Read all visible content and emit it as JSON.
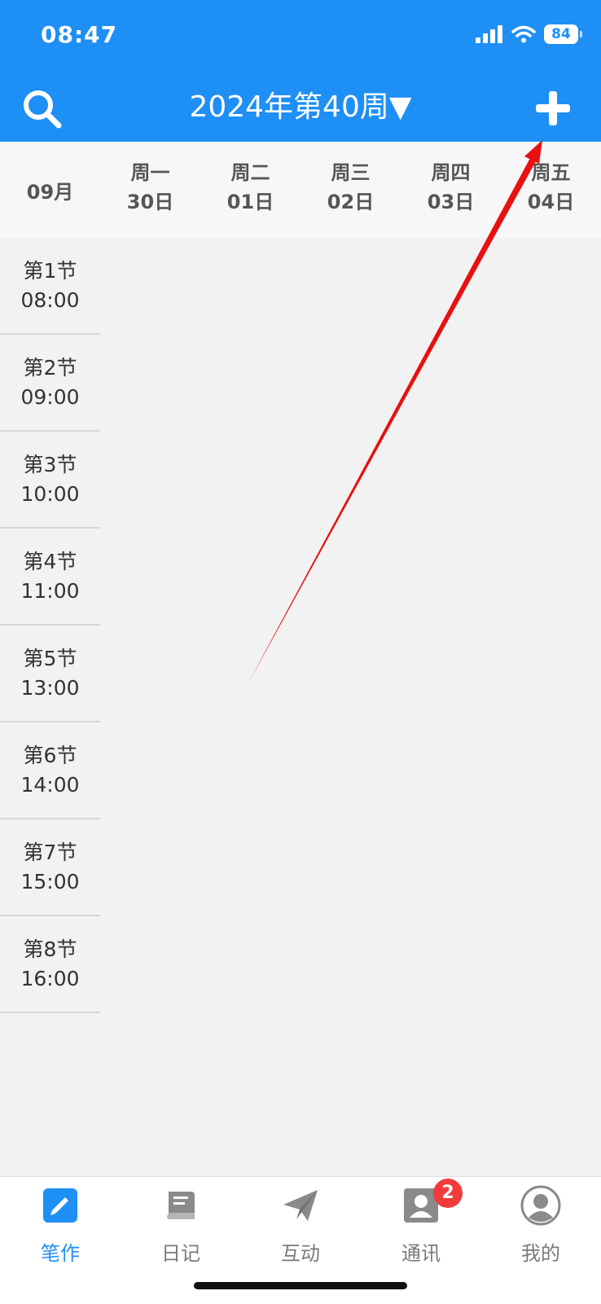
{
  "status_bar": {
    "time": "08:47",
    "battery": "84"
  },
  "header": {
    "title": "2024年第40周▼"
  },
  "date_header": {
    "month": "09月",
    "days": [
      {
        "weekday": "周一",
        "date": "30日"
      },
      {
        "weekday": "周二",
        "date": "01日"
      },
      {
        "weekday": "周三",
        "date": "02日"
      },
      {
        "weekday": "周四",
        "date": "03日"
      },
      {
        "weekday": "周五",
        "date": "04日"
      }
    ]
  },
  "periods": [
    {
      "label": "第1节",
      "time": "08:00"
    },
    {
      "label": "第2节",
      "time": "09:00"
    },
    {
      "label": "第3节",
      "time": "10:00"
    },
    {
      "label": "第4节",
      "time": "11:00"
    },
    {
      "label": "第5节",
      "time": "13:00"
    },
    {
      "label": "第6节",
      "time": "14:00"
    },
    {
      "label": "第7节",
      "time": "15:00"
    },
    {
      "label": "第8节",
      "time": "16:00"
    }
  ],
  "tabbar": {
    "items": [
      {
        "label": "笔作",
        "icon": "pencil-icon",
        "active": true
      },
      {
        "label": "日记",
        "icon": "book-icon",
        "active": false
      },
      {
        "label": "互动",
        "icon": "paper-plane-icon",
        "active": false
      },
      {
        "label": "通讯",
        "icon": "contact-card-icon",
        "active": false,
        "badge": "2"
      },
      {
        "label": "我的",
        "icon": "user-avatar-icon",
        "active": false
      }
    ]
  },
  "colors": {
    "primary": "#1e8ff5",
    "badge": "#f23a3a",
    "annotation_arrow": "#e81010"
  }
}
